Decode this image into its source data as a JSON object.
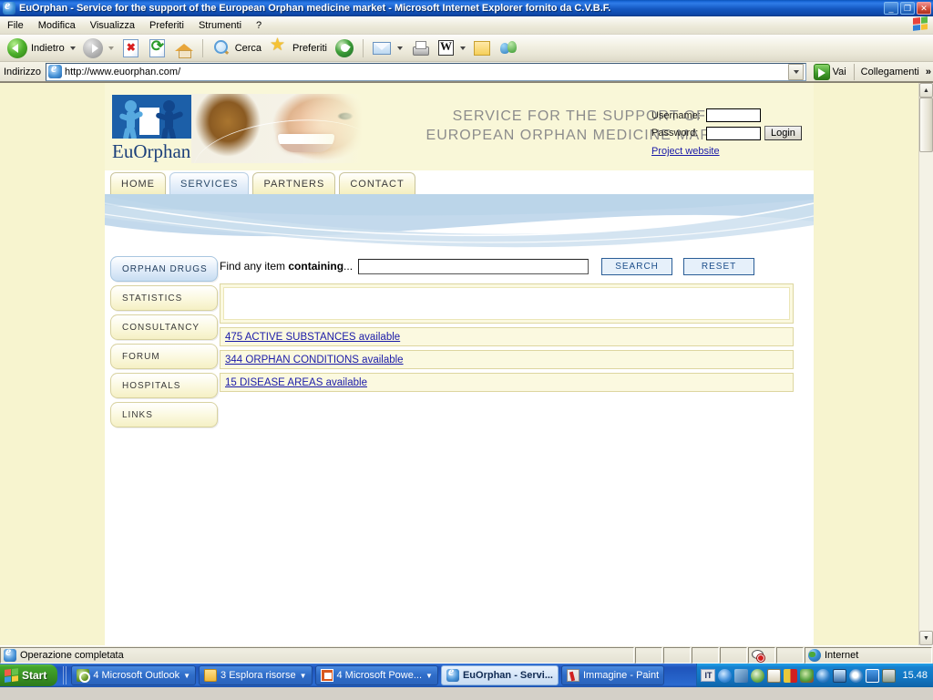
{
  "window": {
    "title": "EuOrphan - Service for the support of the European Orphan medicine market - Microsoft Internet Explorer fornito da C.V.B.F.",
    "minimize": "_",
    "restore": "❐",
    "close": "✕"
  },
  "menubar": {
    "items": [
      "File",
      "Modifica",
      "Visualizza",
      "Preferiti",
      "Strumenti",
      "?"
    ]
  },
  "toolbar": {
    "back_label": "Indietro",
    "search_label": "Cerca",
    "favorites_label": "Preferiti"
  },
  "address": {
    "label": "Indirizzo",
    "url": "http://www.euorphan.com/",
    "go_label": "Vai",
    "links_label": "Collegamenti",
    "chevrons": "»"
  },
  "site": {
    "logo_word": "EuOrphan",
    "headline_line1": "SERVICE FOR THE SUPPORT OF THE",
    "headline_line2": "EUROPEAN ORPHAN MEDICINE MARKET",
    "login": {
      "username_label": "Username:",
      "password_label": "Password:",
      "username_value": "",
      "password_value": "",
      "button_label": "Login",
      "project_link": "Project website"
    },
    "tabs": [
      {
        "label": "HOME",
        "active": false
      },
      {
        "label": "SERVICES",
        "active": true
      },
      {
        "label": "PARTNERS",
        "active": false
      },
      {
        "label": "CONTACT",
        "active": false
      }
    ],
    "sidebar": [
      {
        "label": "ORPHAN DRUGS",
        "active": true
      },
      {
        "label": "STATISTICS",
        "active": false
      },
      {
        "label": "CONSULTANCY",
        "active": false
      },
      {
        "label": "FORUM",
        "active": false
      },
      {
        "label": "HOSPITALS",
        "active": false
      },
      {
        "label": "LINKS",
        "active": false
      }
    ],
    "search": {
      "label_plain": "Find any item ",
      "label_bold": "containing",
      "label_tail": "...",
      "value": "",
      "search_button": "SEARCH",
      "reset_button": "RESET"
    },
    "results": [
      {
        "text": "475 ACTIVE SUBSTANCES available"
      },
      {
        "text": "344 ORPHAN CONDITIONS available"
      },
      {
        "text": "15 DISEASE AREAS available"
      }
    ]
  },
  "statusbar": {
    "message": "Operazione completata",
    "zone": "Internet"
  },
  "taskbar": {
    "start_label": "Start",
    "tasks": [
      {
        "label": "4 Microsoft Outlook",
        "icon": "outlook-icon",
        "active": false,
        "has_arrow": true
      },
      {
        "label": "3 Esplora risorse",
        "icon": "folder-icon",
        "active": false,
        "has_arrow": true
      },
      {
        "label": "4 Microsoft Powe...",
        "icon": "powerpoint-icon",
        "active": false,
        "has_arrow": true
      },
      {
        "label": "EuOrphan - Servi...",
        "icon": "ie-icon",
        "active": true,
        "has_arrow": false
      },
      {
        "label": "Immagine - Paint",
        "icon": "paint-icon",
        "active": false,
        "has_arrow": false
      }
    ],
    "lang": "IT",
    "clock": "15.48"
  },
  "colors": {
    "page_cream": "#f7f4cf",
    "header_cream": "#f9f7d8",
    "link_blue": "#1a1aa8",
    "tab_active": "#d4e4f5",
    "wave_blue": "#bcd6ea"
  }
}
